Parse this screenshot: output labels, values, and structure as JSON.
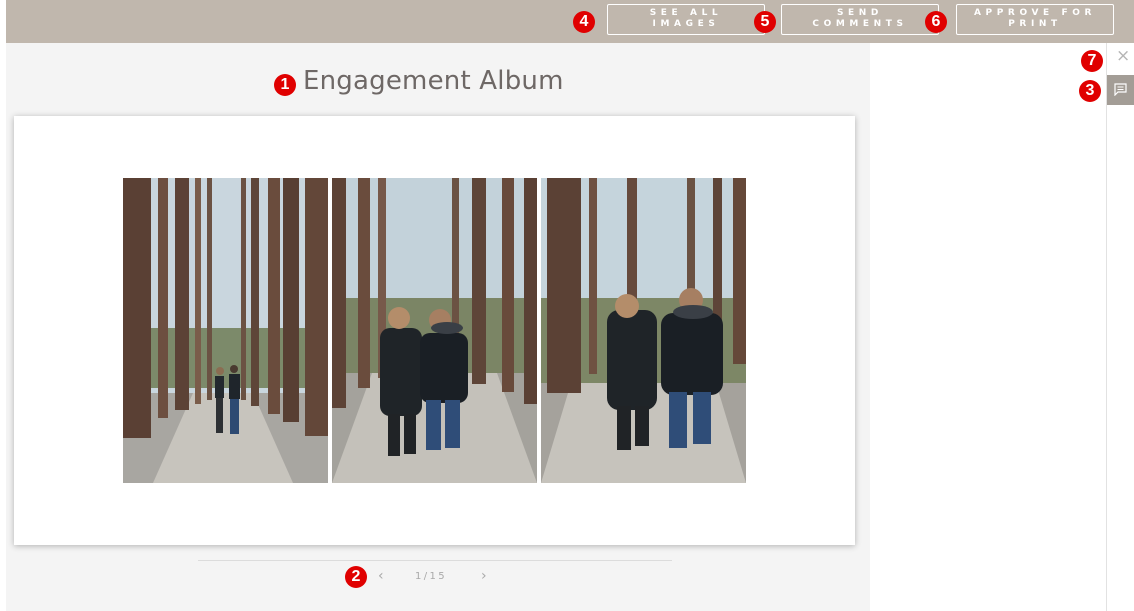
{
  "toolbar": {
    "see_all_line1": "SEE ALL",
    "see_all_line2": "IMAGES",
    "send_line1": "SEND",
    "send_line2": "COMMENTS",
    "approve_line1": "APPROVE FOR",
    "approve_line2": "PRINT"
  },
  "album": {
    "title": "Engagement Album"
  },
  "pager": {
    "prev": "‹",
    "count": "1/15",
    "next": "›"
  },
  "side": {
    "close": "×",
    "comment_icon": "comment-icon"
  },
  "markers": [
    "1",
    "2",
    "3",
    "4",
    "5",
    "6",
    "7"
  ],
  "colors": {
    "topbar": "#c0b7ad",
    "marker": "#e00000",
    "comment_button": "#a39d96",
    "title": "#6e6866"
  }
}
